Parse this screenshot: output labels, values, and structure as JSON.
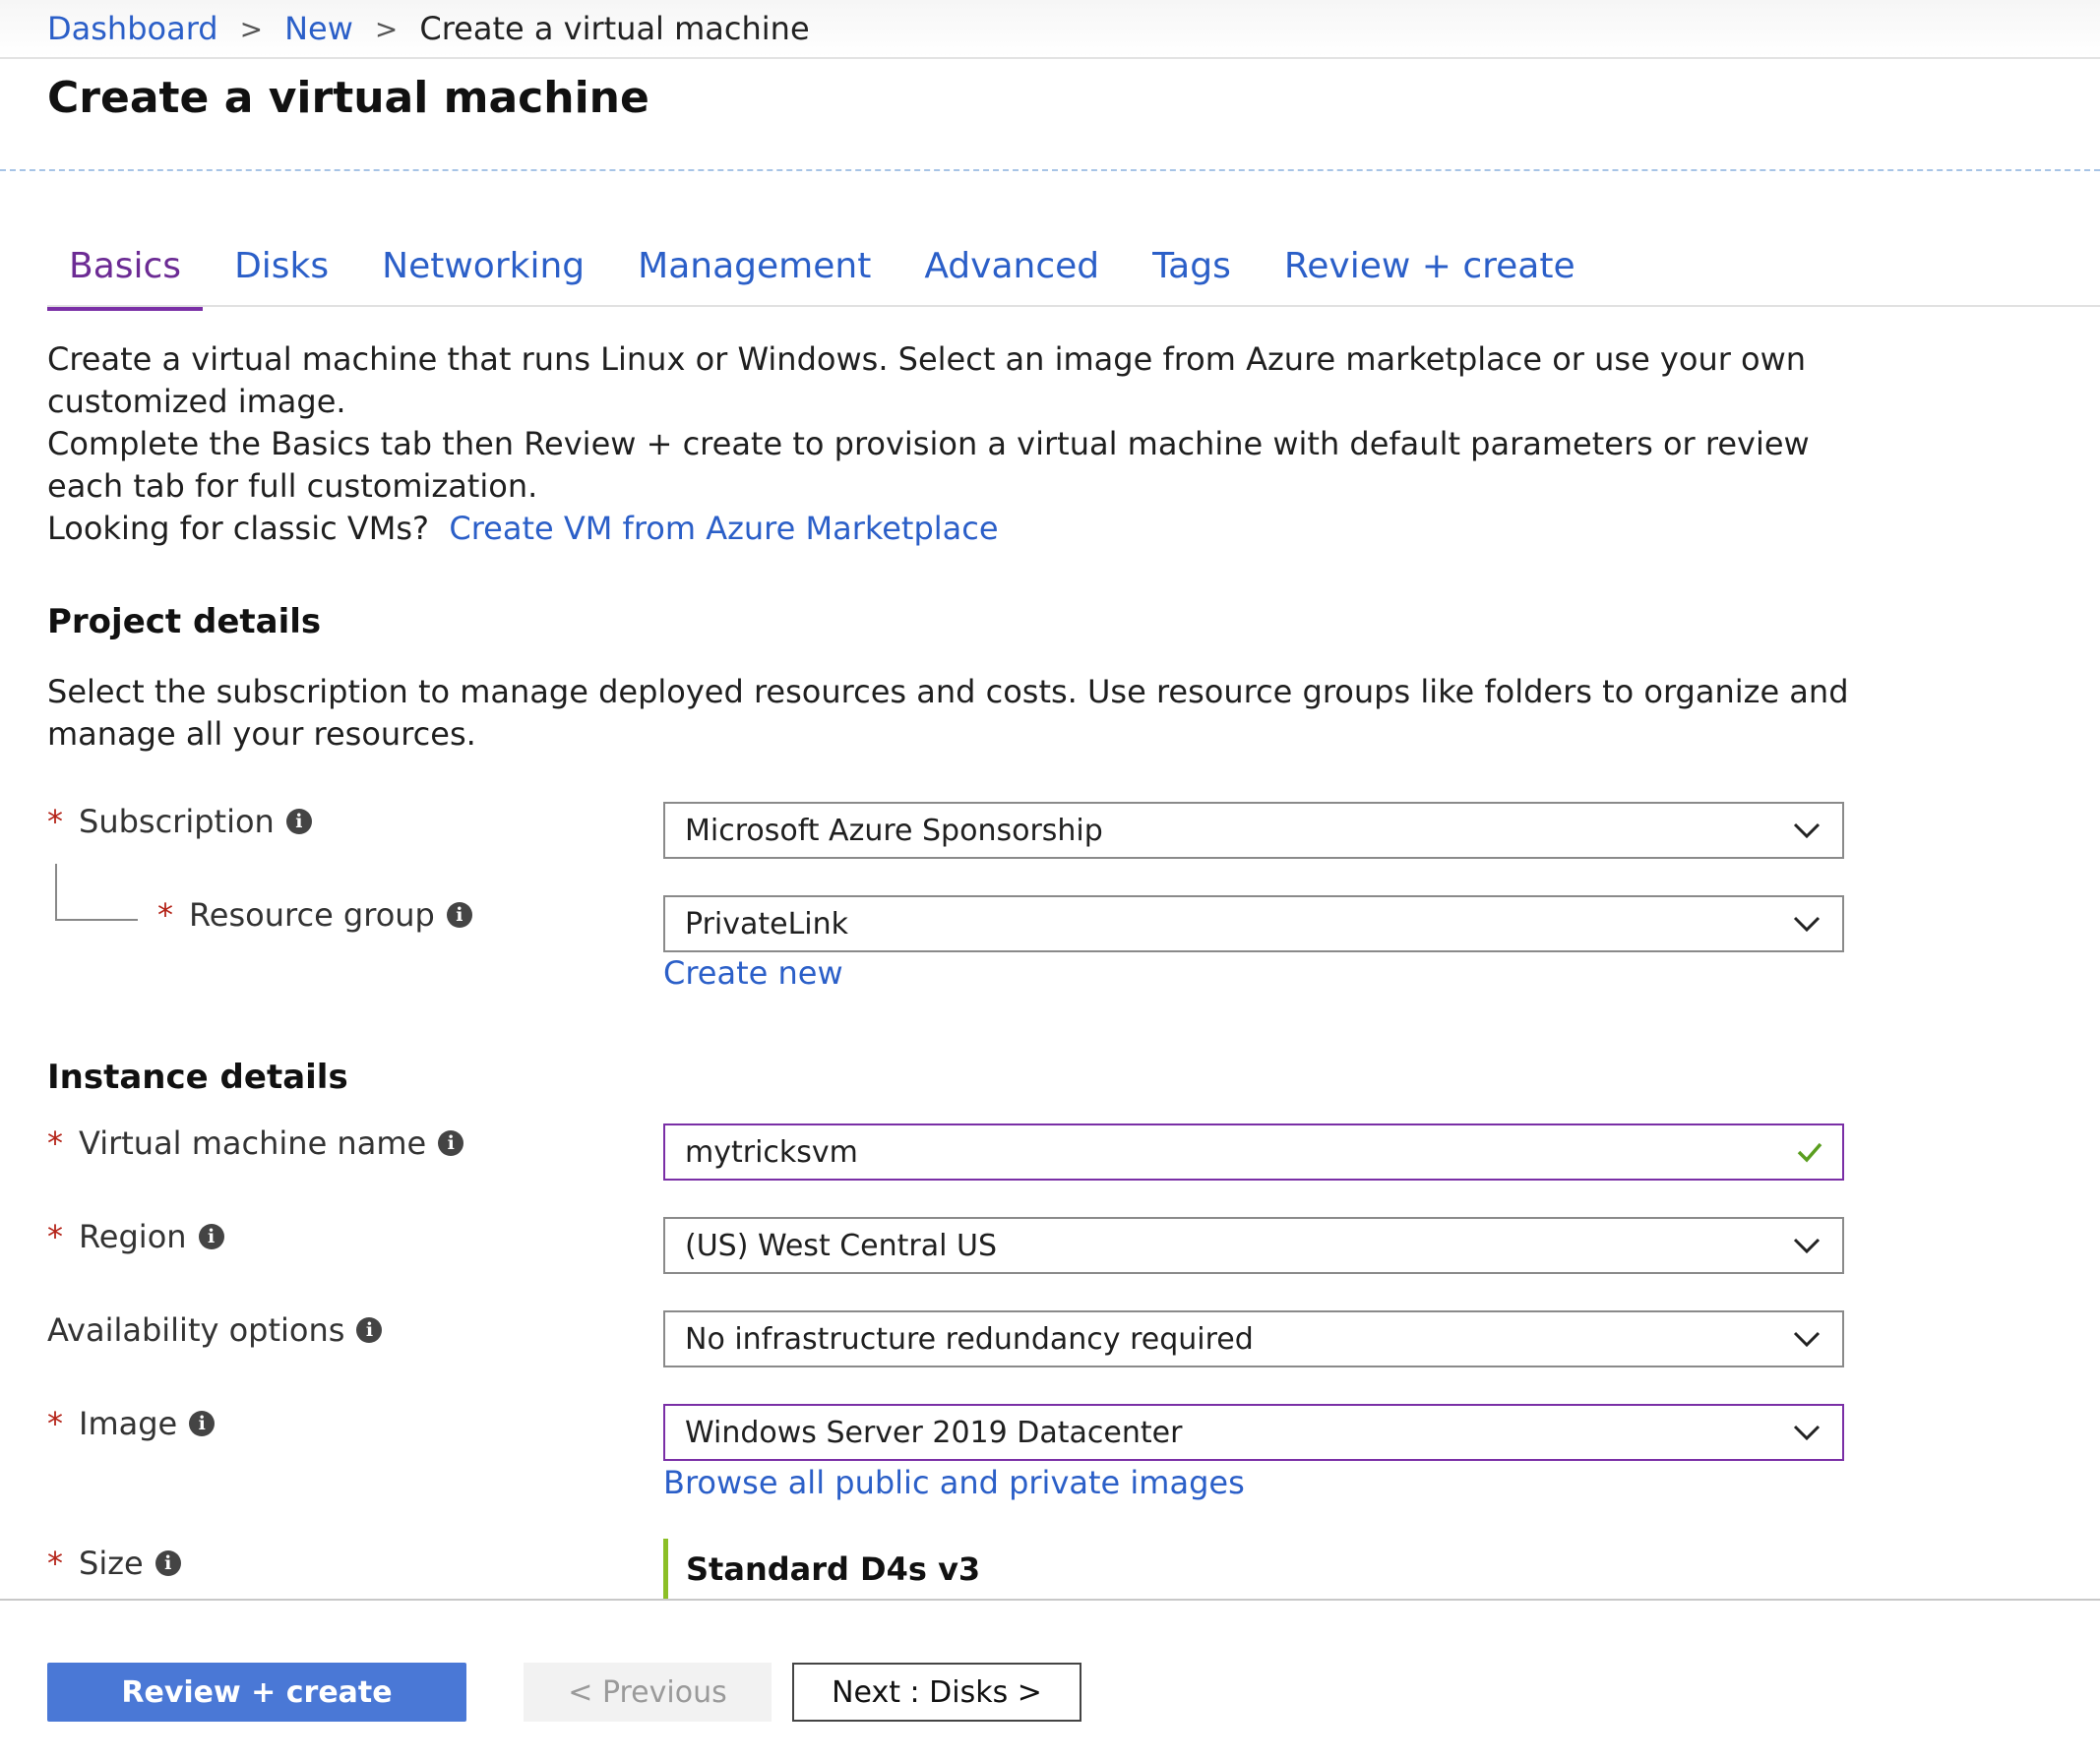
{
  "breadcrumb": {
    "items": [
      "Dashboard",
      "New"
    ],
    "current": "Create a virtual machine",
    "separator": ">"
  },
  "page": {
    "title": "Create a virtual machine"
  },
  "tabs": [
    {
      "label": "Basics",
      "active": true
    },
    {
      "label": "Disks",
      "active": false
    },
    {
      "label": "Networking",
      "active": false
    },
    {
      "label": "Management",
      "active": false
    },
    {
      "label": "Advanced",
      "active": false
    },
    {
      "label": "Tags",
      "active": false
    },
    {
      "label": "Review + create",
      "active": false
    }
  ],
  "intro": {
    "line1": "Create a virtual machine that runs Linux or Windows. Select an image from Azure marketplace or use your own customized image.",
    "line2": "Complete the Basics tab then Review + create to provision a virtual machine with default parameters or review each tab for full customization.",
    "line3_prefix": "Looking for classic VMs?",
    "line3_link": "Create VM from Azure Marketplace"
  },
  "project_details": {
    "heading": "Project details",
    "description": "Select the subscription to manage deployed resources and costs. Use resource groups like folders to organize and manage all your resources.",
    "subscription": {
      "label": "Subscription",
      "value": "Microsoft Azure Sponsorship",
      "required": true
    },
    "resource_group": {
      "label": "Resource group",
      "value": "PrivateLink",
      "required": true,
      "link": "Create new"
    }
  },
  "instance_details": {
    "heading": "Instance details",
    "vm_name": {
      "label": "Virtual machine name",
      "value": "mytricksvm",
      "required": true,
      "valid": true
    },
    "region": {
      "label": "Region",
      "value": "(US) West Central US",
      "required": true
    },
    "availability": {
      "label": "Availability options",
      "value": "No infrastructure redundancy required",
      "required": false
    },
    "image": {
      "label": "Image",
      "value": "Windows Server 2019 Datacenter",
      "required": true,
      "link": "Browse all public and private images"
    },
    "size": {
      "label": "Size",
      "value": "Standard D4s v3",
      "required": true
    }
  },
  "required_marker": "*",
  "info_glyph": "i",
  "footer": {
    "review_create": "Review + create",
    "previous": "< Previous",
    "next": "Next : Disks >"
  },
  "colors": {
    "link": "#2b5fc8",
    "active_tab": "#7a2fa6",
    "primary_button": "#4a78d6",
    "required": "#b42318",
    "valid_check": "#5a9e1f",
    "size_accent": "#8cbf26"
  },
  "icons": {
    "dropdown": "chevron-down-icon",
    "info": "info-icon",
    "valid": "checkmark-icon"
  }
}
